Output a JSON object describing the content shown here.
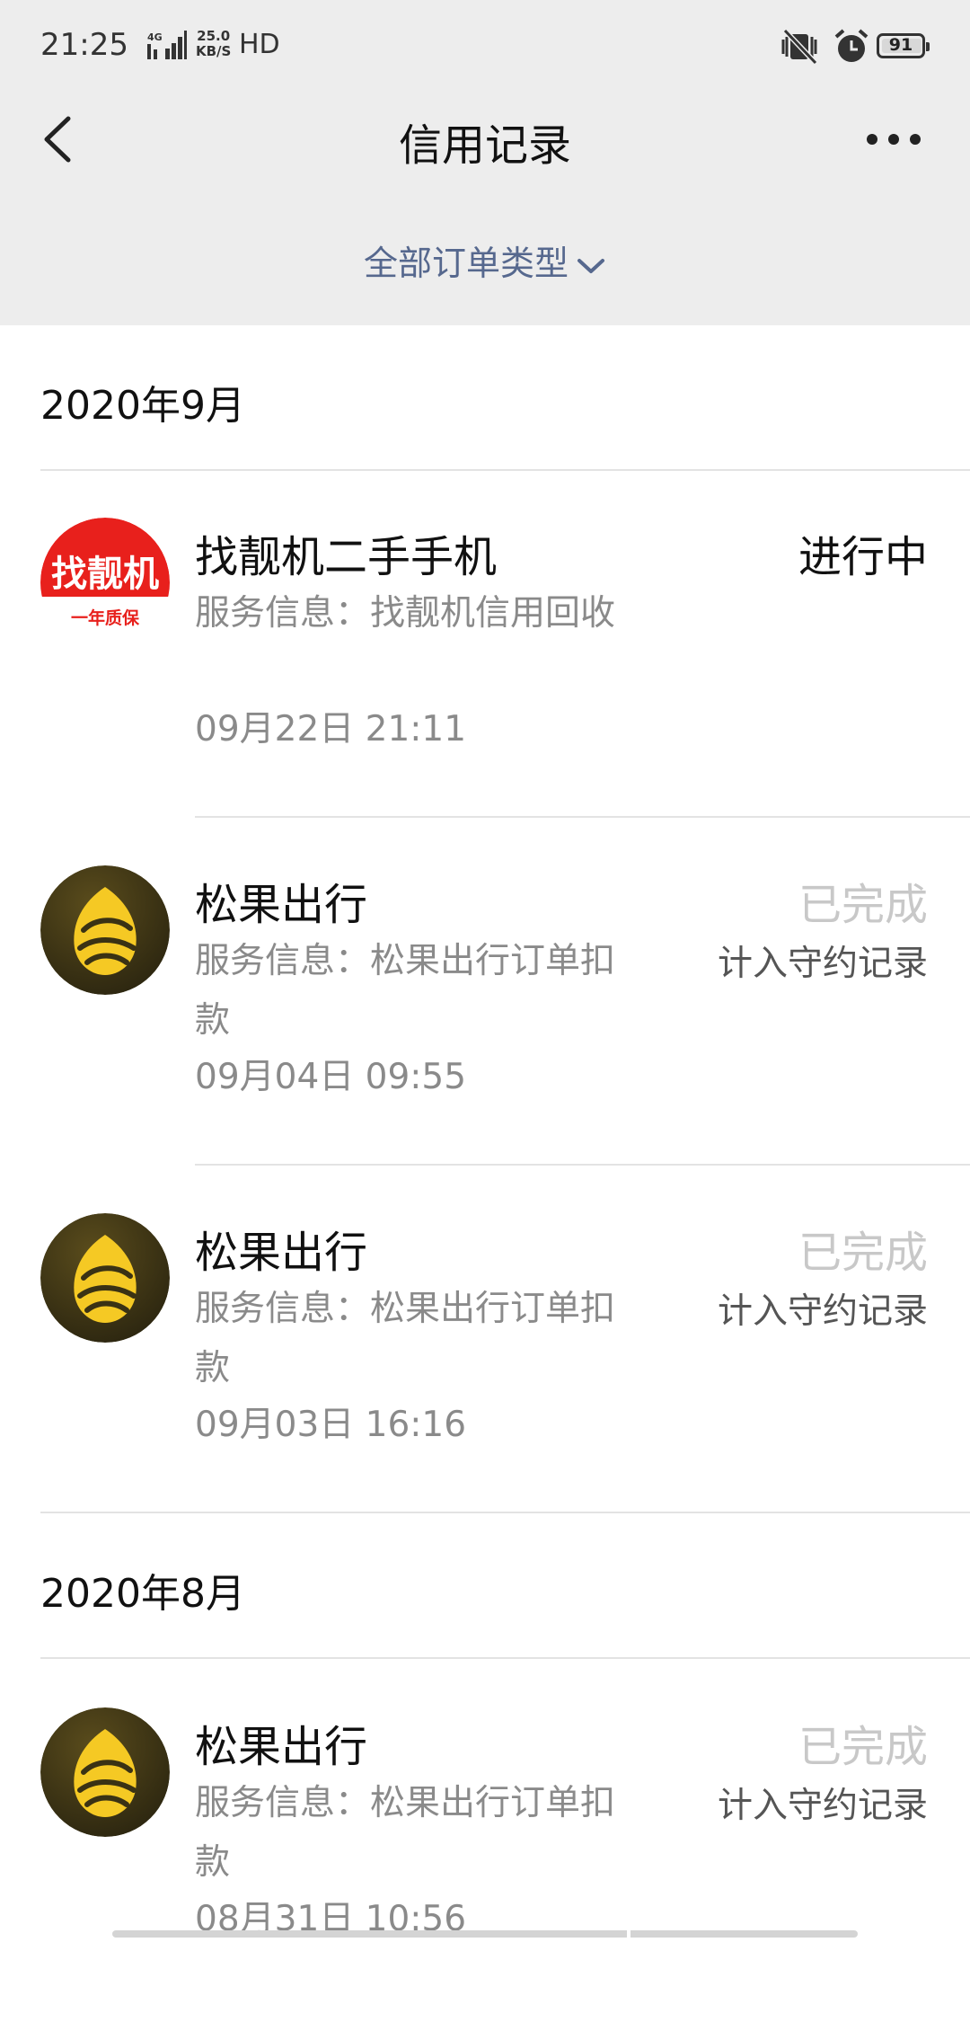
{
  "status_bar": {
    "time": "21:25",
    "network": "4G",
    "speed_value": "25.0",
    "speed_unit": "KB/S",
    "hd": "HD",
    "battery": "91"
  },
  "nav": {
    "title": "信用记录"
  },
  "filter": {
    "label": "全部订单类型"
  },
  "logo_text": {
    "zhaoliangji_main": "找靓机",
    "zhaoliangji_sub": "一年质保"
  },
  "sections": [
    {
      "month": "2020年9月",
      "records": [
        {
          "logo": "zhaoliangji-logo",
          "name": "找靓机二手手机",
          "service": "服务信息：找靓机信用回收",
          "time": "09月22日 21:11",
          "status": "进行中",
          "credit": ""
        },
        {
          "logo": "songguo-logo",
          "name": "松果出行",
          "service": "服务信息：松果出行订单扣款",
          "time": "09月04日 09:55",
          "status": "已完成",
          "credit": "计入守约记录"
        },
        {
          "logo": "songguo-logo",
          "name": "松果出行",
          "service": "服务信息：松果出行订单扣款",
          "time": "09月03日 16:16",
          "status": "已完成",
          "credit": "计入守约记录"
        }
      ]
    },
    {
      "month": "2020年8月",
      "records": [
        {
          "logo": "songguo-logo",
          "name": "松果出行",
          "service": "服务信息：松果出行订单扣款",
          "time": "08月31日 10:56",
          "status": "已完成",
          "credit": "计入守约记录"
        }
      ]
    }
  ],
  "colors": {
    "header_bg": "#ededed",
    "filter_text": "#56688e",
    "zhaoliangji_red": "#e8201c",
    "songguo_yellow": "#f5c924",
    "songguo_dark": "#3a3214"
  }
}
